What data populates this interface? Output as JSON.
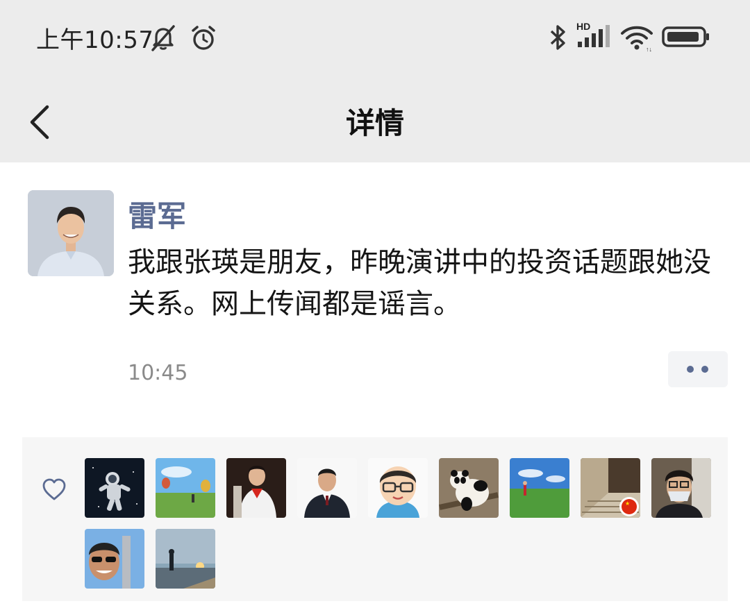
{
  "status_bar": {
    "time": "上午10:57",
    "icons": [
      "mute-bell-icon",
      "alarm-icon",
      "bluetooth-icon",
      "hd-signal-icon",
      "wifi-icon",
      "battery-icon"
    ],
    "hd_label": "HD"
  },
  "nav": {
    "back_icon": "chevron-left-icon",
    "title": "详情"
  },
  "post": {
    "author": "雷军",
    "text": "我跟张瑛是朋友，昨晚演讲中的投资话题跟她没关系。网上传闻都是谣言。",
    "time": "10:45",
    "more_icon": "more-dots-icon"
  },
  "likes": {
    "icon": "heart-outline-icon",
    "avatars": [
      "astronaut",
      "balloon-field",
      "student-red-scarf",
      "man-in-suit",
      "cartoon-glasses",
      "panda",
      "golf-field",
      "stairway-china-flag",
      "masked-man",
      "selfie-sunglasses",
      "sunset-silhouette"
    ]
  },
  "colors": {
    "link_name": "#5b6b92",
    "header_bg": "#ececec",
    "likes_bg": "#f6f6f6",
    "time_text": "#8a8a8a"
  }
}
